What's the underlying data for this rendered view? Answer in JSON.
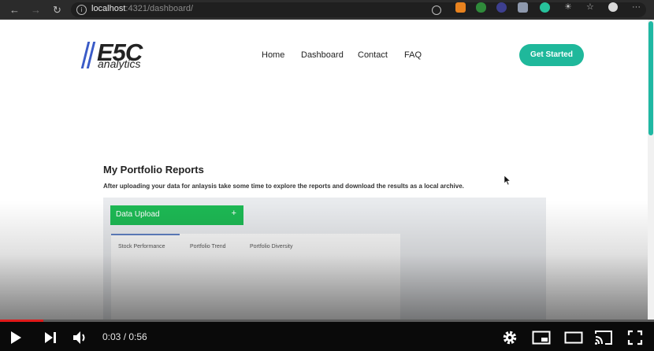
{
  "browser": {
    "url_host": "localhost",
    "url_path": ":4321/dashboard/",
    "extension_icons": [
      "rss-extension-icon",
      "frog-extension-icon",
      "search-extension-icon",
      "puzzle-extension-icon",
      "green-circle-extension-icon",
      "sun-extension-icon",
      "favorites-icon",
      "collections-icon",
      "profile-avatar-icon",
      "more-icon"
    ]
  },
  "site": {
    "logo_main": "E5C",
    "logo_sub": "analytics",
    "nav": [
      {
        "label": "Home"
      },
      {
        "label": "Dashboard"
      },
      {
        "label": "Contact"
      },
      {
        "label": "FAQ"
      }
    ],
    "cta_label": "Get Started",
    "accent_color": "#1fb89b",
    "upload_color": "#1db954"
  },
  "reports": {
    "title": "My Portfolio Reports",
    "description": "After uploading your data for anlaysis take some time to explore the reports and download the results as a local archive.",
    "upload_label": "Data Upload",
    "upload_plus": "+",
    "tabs": [
      {
        "label": "Stock Performance",
        "active": true
      },
      {
        "label": "Portfolio Trend",
        "active": false
      },
      {
        "label": "Portfolio Diversity",
        "active": false
      }
    ]
  },
  "player": {
    "time_current": "0:03",
    "time_total": "0:56",
    "time_display": "0:03 / 0:56",
    "progress_fraction": 0.066,
    "progress_color": "#e01919"
  }
}
